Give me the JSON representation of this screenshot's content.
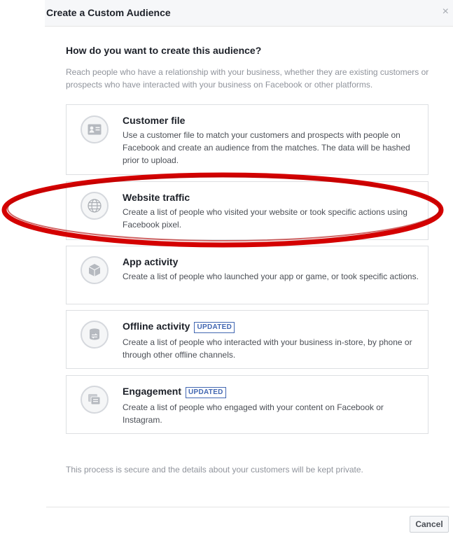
{
  "dialog": {
    "title": "Create a Custom Audience",
    "close_glyph": "×",
    "question": "How do you want to create this audience?",
    "intro": "Reach people who have a relationship with your business, whether they are existing customers or prospects who have interacted with your business on Facebook or other platforms."
  },
  "options": [
    {
      "title": "Customer file",
      "description": "Use a customer file to match your customers and prospects with people on Facebook and create an audience from the matches. The data will be hashed prior to upload.",
      "icon": "contact-card-icon"
    },
    {
      "title": "Website traffic",
      "description": "Create a list of people who visited your website or took specific actions using Facebook pixel.",
      "icon": "globe-icon"
    },
    {
      "title": "App activity",
      "description": "Create a list of people who launched your app or game, or took specific actions.",
      "icon": "cube-icon"
    },
    {
      "title": "Offline activity",
      "badge": "UPDATED",
      "description": "Create a list of people who interacted with your business in-store, by phone or through other offline channels.",
      "icon": "database-sync-icon"
    },
    {
      "title": "Engagement",
      "badge": "UPDATED",
      "description": "Create a list of people who engaged with your content on Facebook or Instagram.",
      "icon": "stacked-cards-icon"
    }
  ],
  "footer": {
    "note": "This process is secure and the details about your customers will be kept private.",
    "cancel_label": "Cancel"
  },
  "colors": {
    "badge": "#4267b2",
    "highlight_ellipse": "#d40000",
    "header_bg": "#f6f7f9"
  }
}
